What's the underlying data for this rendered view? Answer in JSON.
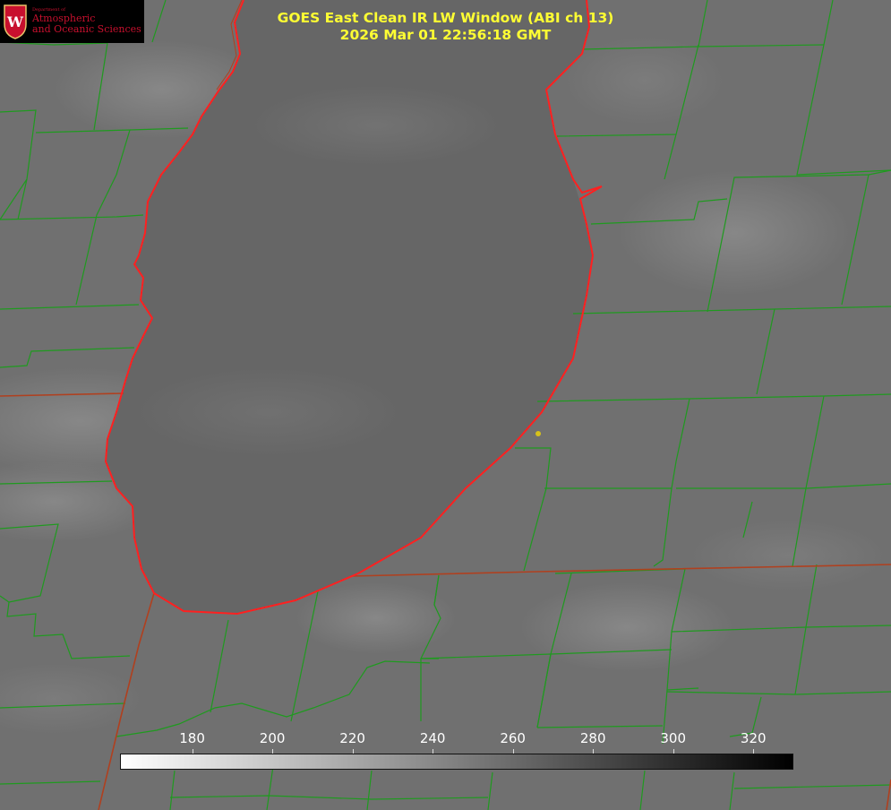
{
  "title": {
    "line1": "GOES East Clean IR LW Window (ABI ch 13)",
    "line2": "2026 Mar 01 22:56:18 GMT"
  },
  "logo": {
    "department": "Department of",
    "line1": "Atmospheric",
    "line2": "and Oceanic Sciences",
    "crest_letter": "W"
  },
  "colorbar": {
    "min": 162,
    "max": 330,
    "ticks": [
      "180",
      "200",
      "220",
      "240",
      "260",
      "280",
      "300",
      "320"
    ],
    "gradient_from": "#ffffff",
    "gradient_to": "#000000"
  },
  "colors": {
    "background": "#6e6e6e",
    "county_lines": "#1f9a1f",
    "state_lines": "#b0401f",
    "coastline": "#ff2020",
    "title": "#ffff33",
    "marker": "#d6c21a"
  }
}
